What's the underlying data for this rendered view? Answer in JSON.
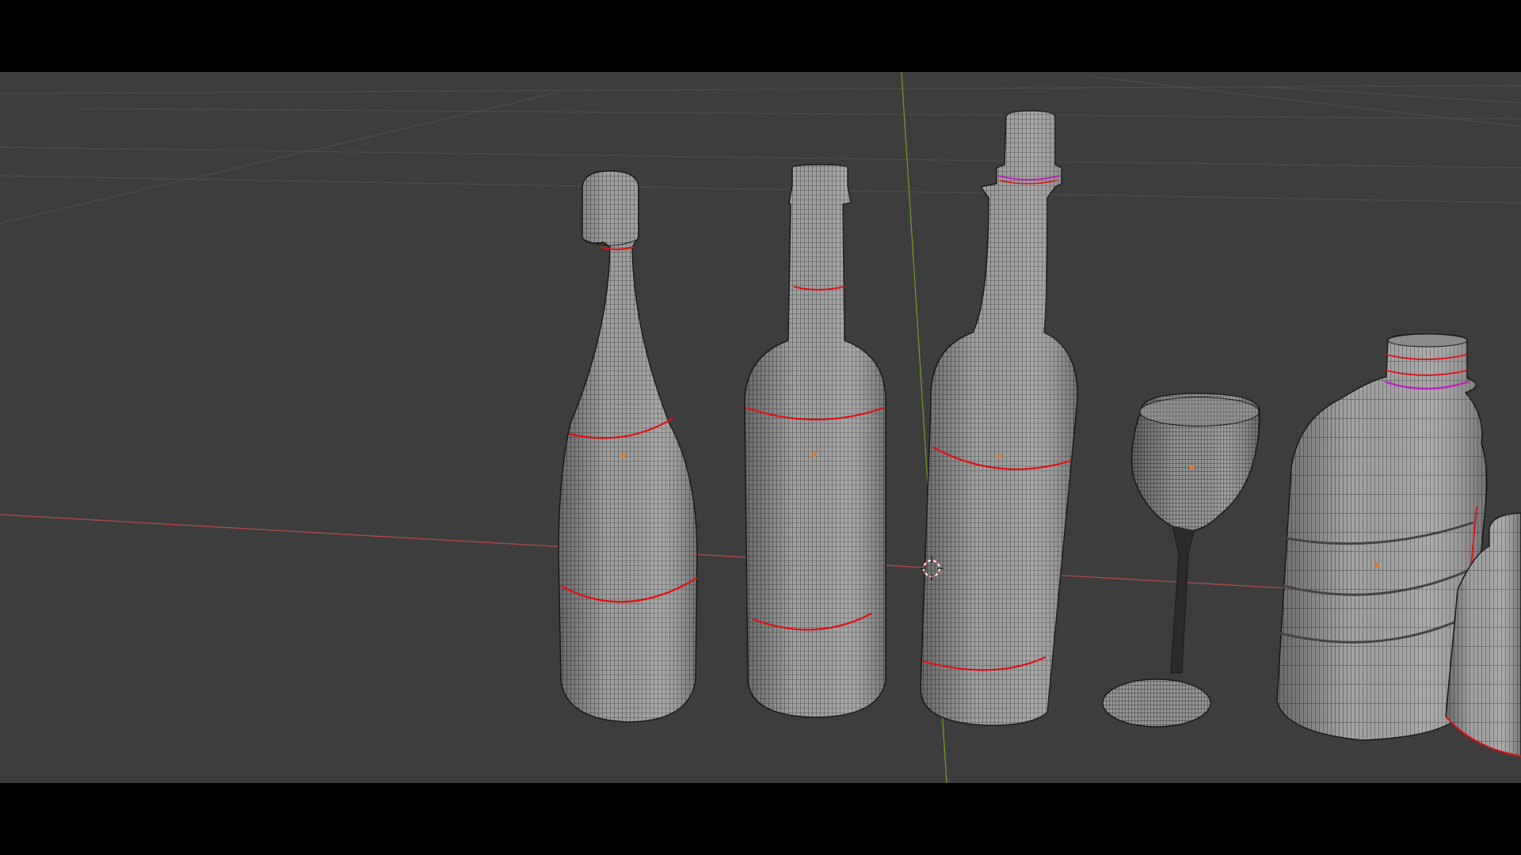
{
  "app": {
    "name": "3D Viewport",
    "mode": "wireframe"
  },
  "colors": {
    "viewport_bg": "#3d3d3d",
    "grid_line": "#4a4a4a",
    "x_axis": "#c24a4a",
    "y_axis": "#6f9a2a",
    "mesh_fill": "#9a9a9a",
    "mesh_wire": "#1c1c1c",
    "seam": "#e01010",
    "selected_ring": "#c020c0",
    "origin_dot": "#e07a30"
  },
  "objects": [
    {
      "name": "champagne-bottle",
      "kind": "bottle"
    },
    {
      "name": "wine-bottle-bordeaux",
      "kind": "bottle"
    },
    {
      "name": "wine-bottle-corked",
      "kind": "bottle"
    },
    {
      "name": "wine-glass",
      "kind": "glass"
    },
    {
      "name": "plastic-bottle",
      "kind": "bottle"
    },
    {
      "name": "partial-bottle",
      "kind": "bottle"
    }
  ],
  "cursor": {
    "icon": "3d-cursor-icon"
  }
}
